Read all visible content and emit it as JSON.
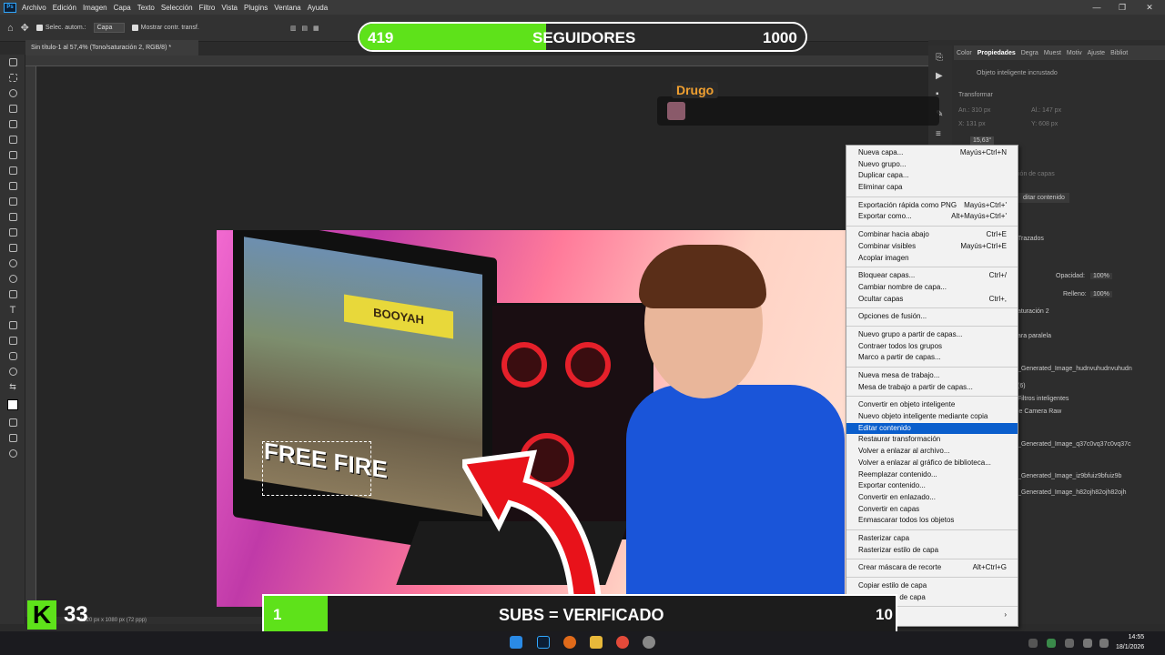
{
  "app": {
    "name": "Photoshop",
    "menu": [
      "Archivo",
      "Edición",
      "Imagen",
      "Capa",
      "Texto",
      "Selección",
      "Filtro",
      "Vista",
      "Plugins",
      "Ventana",
      "Ayuda"
    ]
  },
  "options_bar": {
    "auto_select_label": "Selec. autom.:",
    "auto_select_value": "Capa",
    "show_transform_label": "Mostrar contr. transf."
  },
  "document_tab": "Sin título-1 al 57,4% (Tono/saturación 2, RGB/8) *",
  "status_bar": "1920 px x 1080 px (72 ppp)",
  "artwork": {
    "banner_text": "BOOYAH",
    "logo_text": "FREE FIRE"
  },
  "overlay": {
    "follow_count": "419",
    "follow_label": "SEGUIDORES",
    "follow_goal": "1000",
    "follow_progress": 0.419,
    "chat_user": "Drugo",
    "subs_count": "1",
    "subs_label": "SUBS = VERIFICADO",
    "subs_goal": "10",
    "subs_progress": 0.1,
    "kick_logo": "K",
    "kick_number": "33"
  },
  "properties_panel": {
    "tabs": [
      "Color",
      "Propiedades",
      "Degra",
      "Muest",
      "Motiv",
      "Ajuste",
      "Bibliot"
    ],
    "active_tab": "Propiedades",
    "object_type": "Objeto inteligente incrustado",
    "transform_label": "Transformar",
    "width": "An.: 310 px",
    "height": "Al.: 147 px",
    "x": "X: 131 px",
    "y": "Y: 608 px",
    "angle": "15,63°",
    "layer_comps": "ión de capas",
    "edit_contents_btn": "ditar contenido"
  },
  "layers_panel": {
    "tab": "Trazados",
    "opacity_label": "Opacidad:",
    "opacity_value": "100%",
    "fill_label": "Relleno:",
    "fill_value": "100%",
    "layers": [
      "aturación 2",
      "ara paralela",
      "_Generated_Image_hudnvuhudnvuhudn",
      "(6)",
      "Filtros inteligentes",
      "le Camera Raw",
      "_Generated_Image_q37c0vq37c0vq37c",
      "_Generated_Image_iz9bfuiz9bfuiz9b",
      "_Generated_Image_h82ojh82ojh82ojh"
    ]
  },
  "context_menu": {
    "groups": [
      [
        {
          "label": "Nueva capa...",
          "shortcut": "Mayús+Ctrl+N"
        },
        {
          "label": "Nuevo grupo...",
          "shortcut": ""
        },
        {
          "label": "Duplicar capa...",
          "shortcut": ""
        },
        {
          "label": "Eliminar capa",
          "shortcut": ""
        }
      ],
      [
        {
          "label": "Exportación rápida como PNG",
          "shortcut": "Mayús+Ctrl+'"
        },
        {
          "label": "Exportar como...",
          "shortcut": "Alt+Mayús+Ctrl+'"
        }
      ],
      [
        {
          "label": "Combinar hacia abajo",
          "shortcut": "Ctrl+E"
        },
        {
          "label": "Combinar visibles",
          "shortcut": "Mayús+Ctrl+E"
        },
        {
          "label": "Acoplar imagen",
          "shortcut": ""
        }
      ],
      [
        {
          "label": "Bloquear capas...",
          "shortcut": "Ctrl+/"
        },
        {
          "label": "Cambiar nombre de capa...",
          "shortcut": ""
        },
        {
          "label": "Ocultar capas",
          "shortcut": "Ctrl+,"
        }
      ],
      [
        {
          "label": "Opciones de fusión...",
          "shortcut": ""
        }
      ],
      [
        {
          "label": "Nuevo grupo a partir de capas...",
          "shortcut": ""
        },
        {
          "label": "Contraer todos los grupos",
          "shortcut": ""
        },
        {
          "label": "Marco a partir de capas...",
          "shortcut": ""
        }
      ],
      [
        {
          "label": "Nueva mesa de trabajo...",
          "shortcut": ""
        },
        {
          "label": "Mesa de trabajo a partir de capas...",
          "shortcut": ""
        }
      ],
      [
        {
          "label": "Convertir en objeto inteligente",
          "shortcut": ""
        },
        {
          "label": "Nuevo objeto inteligente mediante copia",
          "shortcut": ""
        },
        {
          "label": "Editar contenido",
          "shortcut": "",
          "highlight": true
        },
        {
          "label": "Restaurar transformación",
          "shortcut": ""
        },
        {
          "label": "Volver a enlazar al archivo...",
          "shortcut": ""
        },
        {
          "label": "Volver a enlazar al gráfico de biblioteca...",
          "shortcut": ""
        },
        {
          "label": "Reemplazar contenido...",
          "shortcut": ""
        },
        {
          "label": "Exportar contenido...",
          "shortcut": ""
        },
        {
          "label": "Convertir en enlazado...",
          "shortcut": ""
        },
        {
          "label": "Convertir en capas",
          "shortcut": ""
        },
        {
          "label": "Enmascarar todos los objetos",
          "shortcut": ""
        }
      ],
      [
        {
          "label": "Rasterizar capa",
          "shortcut": ""
        },
        {
          "label": "Rasterizar estilo de capa",
          "shortcut": ""
        }
      ],
      [
        {
          "label": "Crear máscara de recorte",
          "shortcut": "Alt+Ctrl+G"
        }
      ],
      [
        {
          "label": "Copiar estilo de capa",
          "shortcut": ""
        },
        {
          "label": "Borrar estilo de capa",
          "shortcut": ""
        }
      ],
      [
        {
          "label": "Color",
          "shortcut": "›"
        }
      ]
    ]
  },
  "taskbar": {
    "time": "14:55",
    "date": "18/1/2026"
  },
  "colors": {
    "accent_green": "#5ee21a",
    "menu_highlight": "#0a5ecc",
    "chat_name": "#f0a030"
  }
}
